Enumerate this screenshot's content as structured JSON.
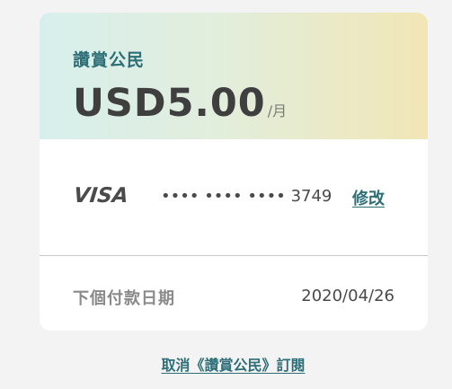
{
  "plan": {
    "name": "讚賞公民",
    "price": "USD5.00",
    "period": "/月"
  },
  "payment": {
    "brand": "VISA",
    "masked_number": "•••• •••• •••• 3749",
    "edit_label": "修改"
  },
  "next_payment": {
    "label": "下個付款日期",
    "date": "2020/04/26"
  },
  "cancel_label": "取消《讚賞公民》訂閱",
  "colors": {
    "accent": "#2d6e77",
    "header_gradient_start": "#d7efec",
    "header_gradient_end": "#f1e6b6"
  }
}
